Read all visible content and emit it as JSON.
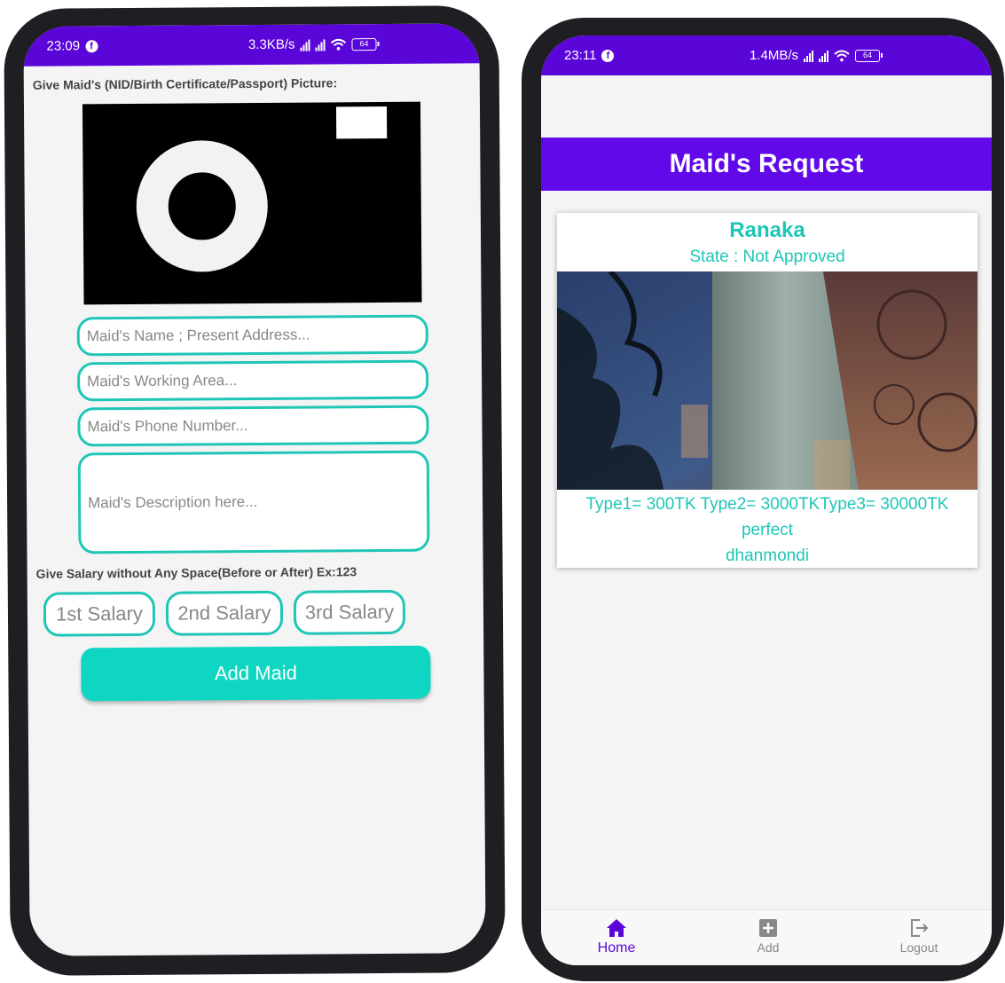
{
  "left_screen": {
    "status": {
      "time": "23:09",
      "speed": "3.3KB/s",
      "battery": "64"
    },
    "picture_label": "Give Maid's (NID/Birth Certificate/Passport) Picture:",
    "fields": {
      "name_address_placeholder": "Maid's Name ; Present Address...",
      "working_area_placeholder": "Maid's Working Area...",
      "phone_placeholder": "Maid's Phone Number...",
      "description_placeholder": "Maid's Description here..."
    },
    "salary_label": "Give Salary without Any Space(Before or After) Ex:123",
    "salary_fields": [
      "1st Salary",
      "2nd Salary",
      "3rd Salary"
    ],
    "add_button": "Add Maid"
  },
  "right_screen": {
    "status": {
      "time": "23:11",
      "speed": "1.4MB/s",
      "battery": "64"
    },
    "title": "Maid's Request",
    "card": {
      "name": "Ranaka",
      "state": "State : Not Approved",
      "types": "Type1= 300TK  Type2= 3000TKType3= 30000TK",
      "description": "perfect",
      "area": "dhanmondi"
    },
    "nav": [
      {
        "label": "Home",
        "icon": "home-icon",
        "active": true
      },
      {
        "label": "Add",
        "icon": "add-box-icon",
        "active": false
      },
      {
        "label": "Logout",
        "icon": "logout-icon",
        "active": false
      }
    ]
  },
  "colors": {
    "primary": "#5b06d8",
    "accent": "#1fc6b6",
    "button": "#0fd6c2"
  }
}
